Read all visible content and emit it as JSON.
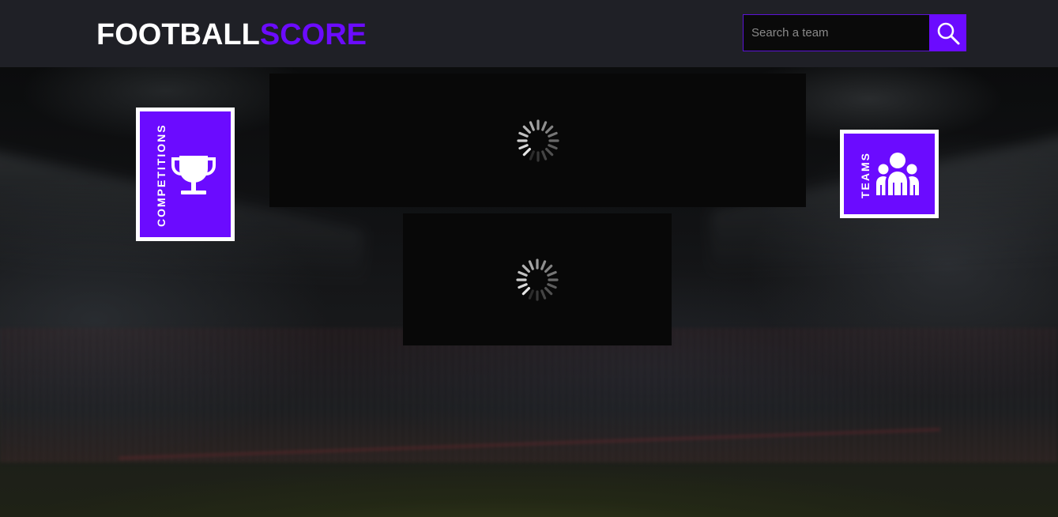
{
  "header": {
    "logo_part1": "FOOTBALL",
    "logo_part2": "SCORE",
    "brand_color": "#6b0bff",
    "search": {
      "placeholder": "Search a team",
      "value": "",
      "button_icon": "search-icon"
    }
  },
  "nav": {
    "competitions": {
      "label": "COMPETITIONS",
      "icon": "trophy-icon"
    },
    "teams": {
      "label": "TEAMS",
      "icon": "users-group-icon"
    }
  },
  "panels": [
    {
      "state": "loading",
      "icon": "spinner-icon"
    },
    {
      "state": "loading",
      "icon": "spinner-icon"
    }
  ]
}
